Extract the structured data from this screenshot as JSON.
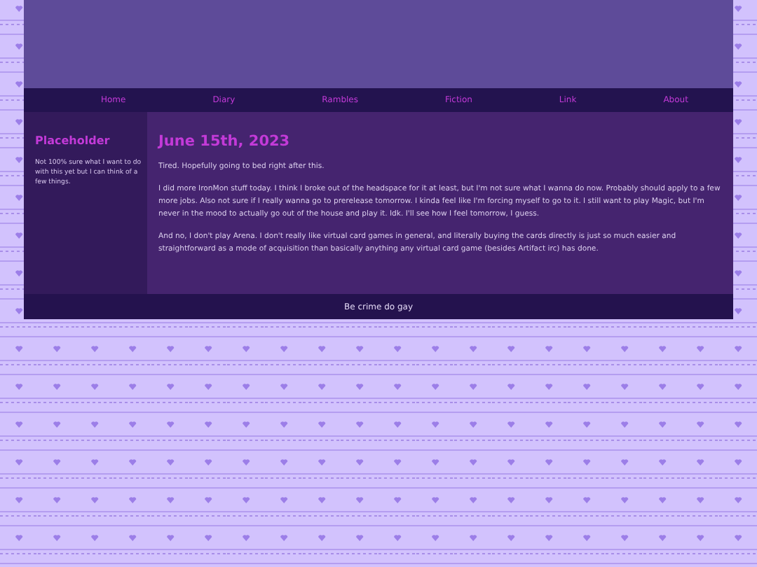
{
  "nav": [
    {
      "label": "Home"
    },
    {
      "label": "Diary"
    },
    {
      "label": "Rambles"
    },
    {
      "label": "Fiction"
    },
    {
      "label": "Link"
    },
    {
      "label": "About"
    }
  ],
  "sidebar": {
    "title": "Placeholder",
    "text": "Not 100% sure what I want to do with this yet but I can think of a few things."
  },
  "post": {
    "title": "June 15th, 2023",
    "paragraphs": [
      "Tired. Hopefully going to bed right after this.",
      "I did more IronMon stuff today. I think I broke out of the headspace for it at least, but I'm not sure what I wanna do now. Probably should apply to a few more jobs. Also not sure if I really wanna go to prerelease tomorrow. I kinda feel like I'm forcing myself to go to it. I still want to play Magic, but I'm never in the mood to actually go out of the house and play it. Idk. I'll see how I feel tomorrow, I guess.",
      "And no, I don't play Arena. I don't really like virtual card games in general, and literally buying the cards directly is just so much easier and straightforward as a mode of acquisition than basically anything any virtual card game (besides Artifact irc) has done."
    ]
  },
  "footer": "Be crime do gay"
}
